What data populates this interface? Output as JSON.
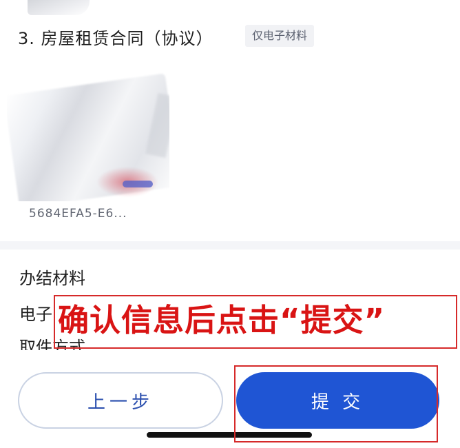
{
  "section": {
    "title": "3. 房屋租赁合同（协议）",
    "tag": "仅电子材料",
    "attachment": {
      "file_name": "5684EFA5-E6..."
    }
  },
  "result_materials": {
    "title": "办结材料",
    "electronic_label": "电子",
    "pickup_label": "取件方式"
  },
  "buttons": {
    "prev": "上一步",
    "submit": "提 交"
  },
  "annotation": {
    "text": "确认信息后点击“提交”",
    "color": "#d91414"
  },
  "colors": {
    "primary": "#1f55d4",
    "accent_red": "#d62a2a"
  }
}
